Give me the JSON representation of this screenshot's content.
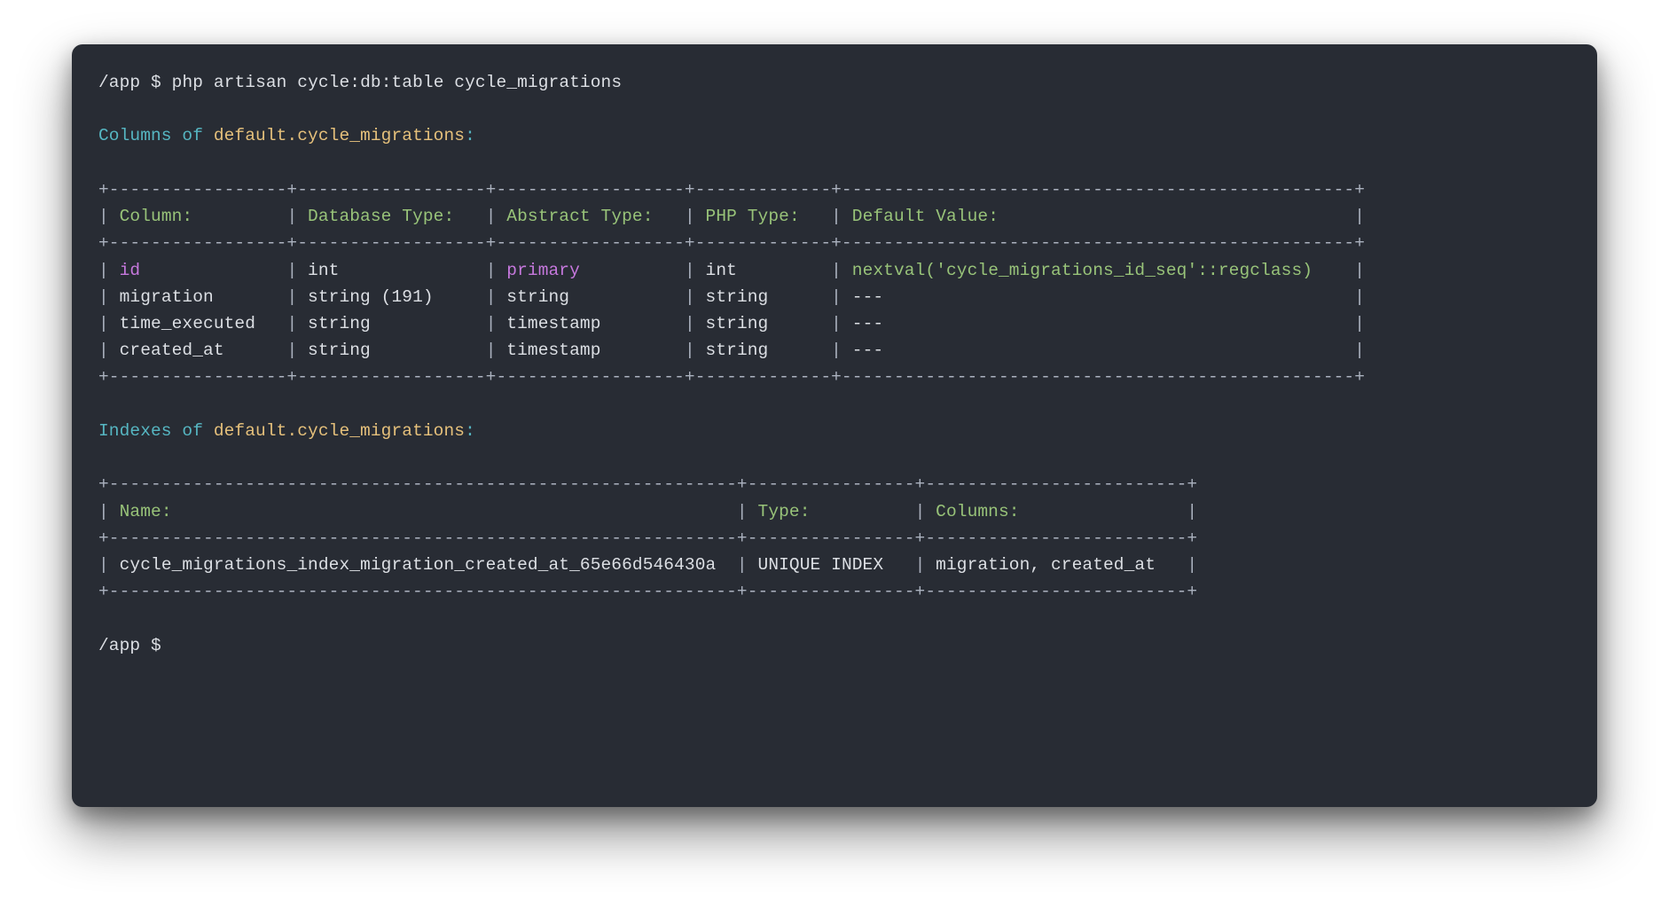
{
  "prompt": {
    "path": "/app",
    "symbol": "$",
    "command": "php artisan cycle:db:table cycle_migrations"
  },
  "sections": {
    "columns_heading_prefix": "Columns of ",
    "indexes_heading_prefix": "Indexes of ",
    "table_fqn": "default.cycle_migrations",
    "colon": ":"
  },
  "columns_table": {
    "headers": {
      "column": "Column:",
      "db_type": "Database Type:",
      "abstract_type": "Abstract Type:",
      "php_type": "PHP Type:",
      "default_value": "Default Value:"
    },
    "rows": [
      {
        "column": "id",
        "db_type": "int",
        "abstract_type": "primary",
        "php_type": "int",
        "default_value": "nextval('cycle_migrations_id_seq'::regclass)"
      },
      {
        "column": "migration",
        "db_type": "string (191)",
        "abstract_type": "string",
        "php_type": "string",
        "default_value": "---"
      },
      {
        "column": "time_executed",
        "db_type": "string",
        "abstract_type": "timestamp",
        "php_type": "string",
        "default_value": "---"
      },
      {
        "column": "created_at",
        "db_type": "string",
        "abstract_type": "timestamp",
        "php_type": "string",
        "default_value": "---"
      }
    ],
    "widths": {
      "column": 15,
      "db_type": 16,
      "abstract_type": 16,
      "php_type": 11,
      "default_value": 47
    }
  },
  "indexes_table": {
    "headers": {
      "name": "Name:",
      "type": "Type:",
      "columns": "Columns:"
    },
    "rows": [
      {
        "name": "cycle_migrations_index_migration_created_at_65e66d546430a",
        "type": "UNIQUE INDEX",
        "columns": "migration, created_at"
      }
    ],
    "widths": {
      "name": 58,
      "type": 14,
      "columns": 23
    }
  },
  "end_prompt": {
    "path": "/app",
    "symbol": "$"
  }
}
